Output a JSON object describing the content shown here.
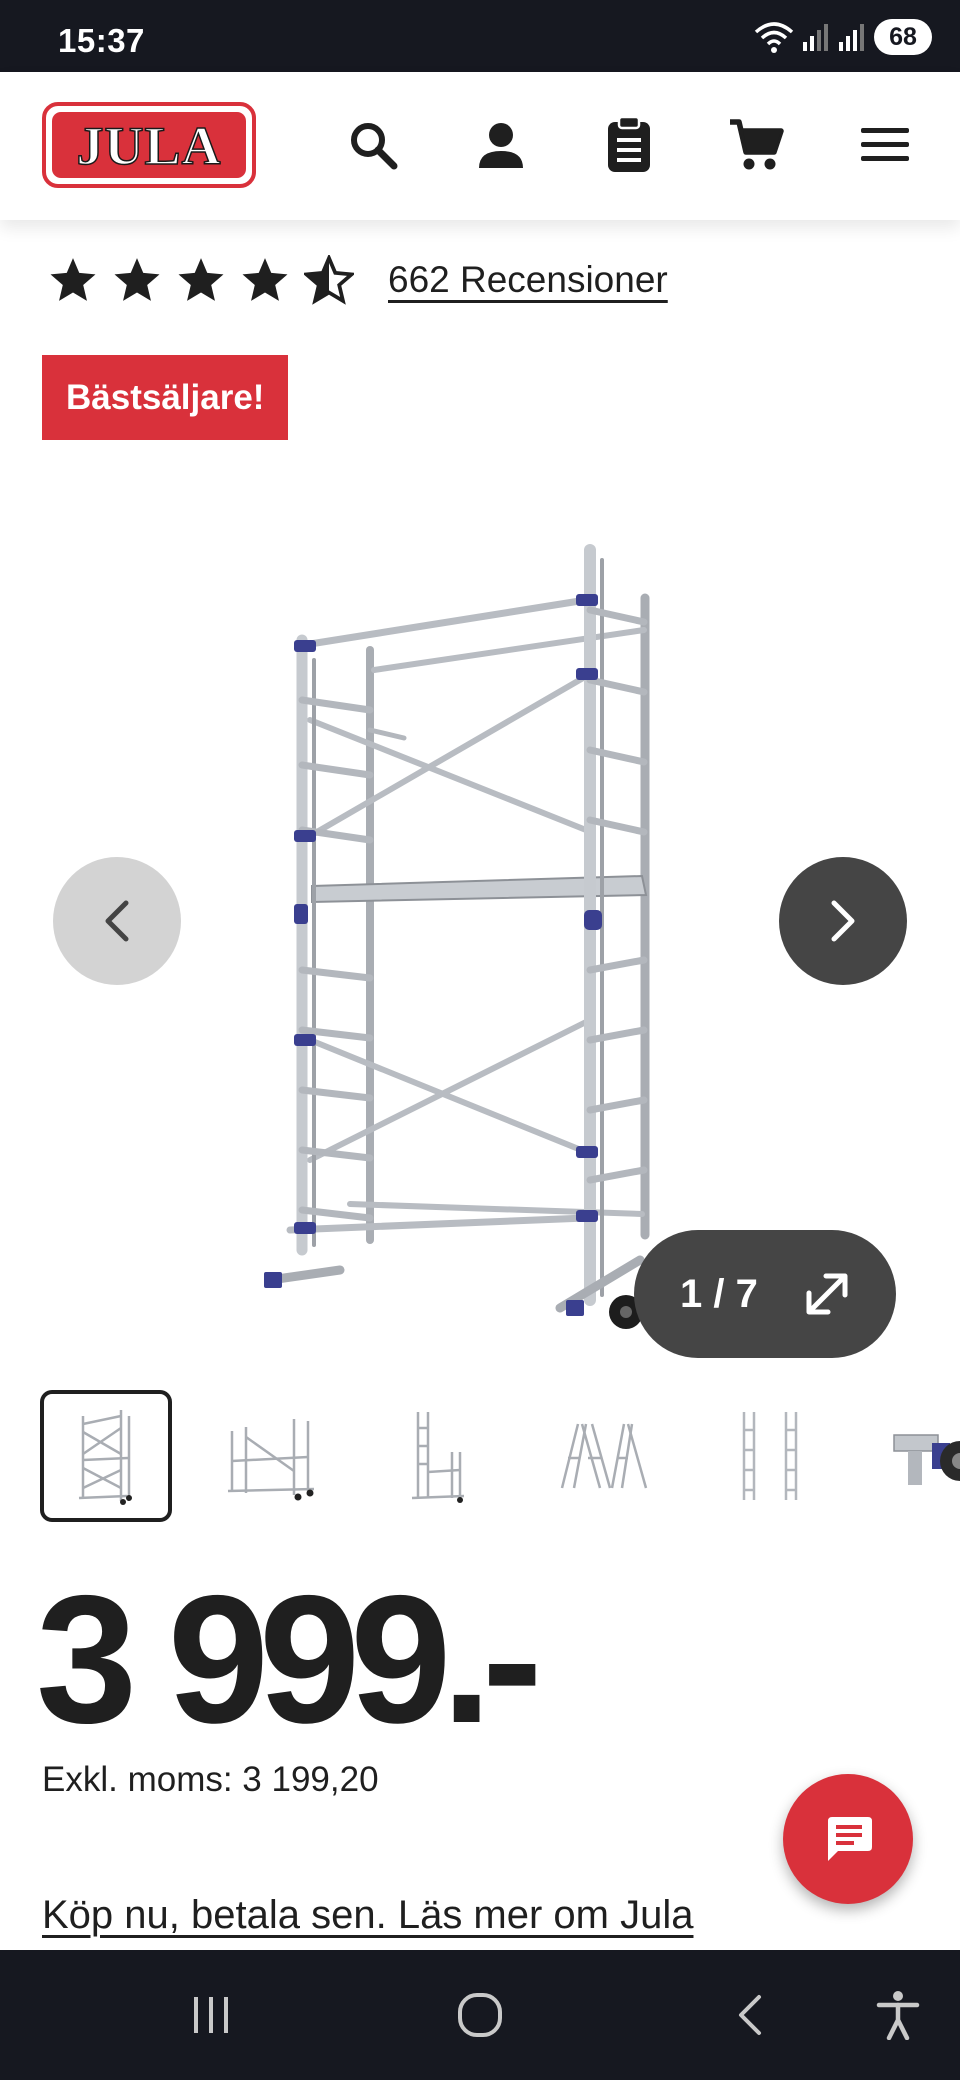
{
  "status_bar": {
    "time": "15:37",
    "battery": "68"
  },
  "header": {
    "logo_text": "JULA",
    "icons": [
      "search-icon",
      "account-icon",
      "clipboard-list-icon",
      "cart-icon",
      "menu-icon"
    ]
  },
  "product": {
    "rating": 4.5,
    "rating_max": 5,
    "reviews_link": "662 Recensioner",
    "badge": "Bästsäljare!",
    "price": "3 999.-",
    "vat_line": "Exkl. moms: 3 199,20",
    "klarna_link": "Köp nu, betala sen. Läs mer om Jula"
  },
  "gallery": {
    "counter": "1 / 7",
    "thumbnail_count": 6,
    "active_thumbnail": 1
  },
  "colors": {
    "brand_red": "#d9313b",
    "dark": "#161820",
    "nav_dark": "#454545",
    "nav_light": "#d3d3d3",
    "accent_blue": "#3a3f8f"
  }
}
